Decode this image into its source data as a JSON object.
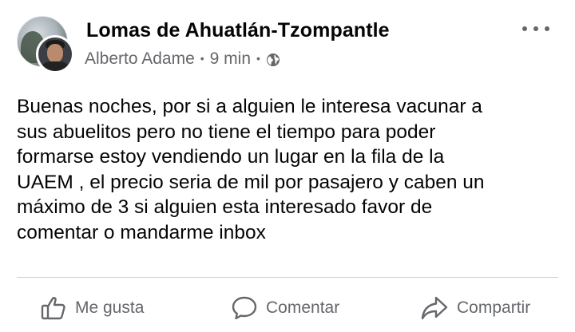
{
  "header": {
    "group_name": "Lomas de Ahuatlán-Tzompantle",
    "author": "Alberto Adame",
    "separator": "•",
    "time": "9 min",
    "privacy_icon": "globe-icon",
    "more_icon": "more-options-icon"
  },
  "post": {
    "lines": [
      "Buenas noches, por si a alguien le interesa vacunar a",
      "sus abuelitos pero no tiene el tiempo para poder",
      "formarse estoy vendiendo un lugar en la fila de la",
      "UAEM , el precio seria de mil por pasajero y caben un",
      "máximo de 3 si alguien esta interesado favor de",
      "comentar o mandarme inbox"
    ]
  },
  "actions": {
    "like_label": "Me gusta",
    "comment_label": "Comentar",
    "share_label": "Compartir",
    "like_icon": "thumbs-up-icon",
    "comment_icon": "comment-bubble-icon",
    "share_icon": "share-arrow-icon"
  },
  "colors": {
    "text_primary": "#050505",
    "text_secondary": "#65676b",
    "divider": "#ced0d4",
    "background": "#ffffff"
  }
}
